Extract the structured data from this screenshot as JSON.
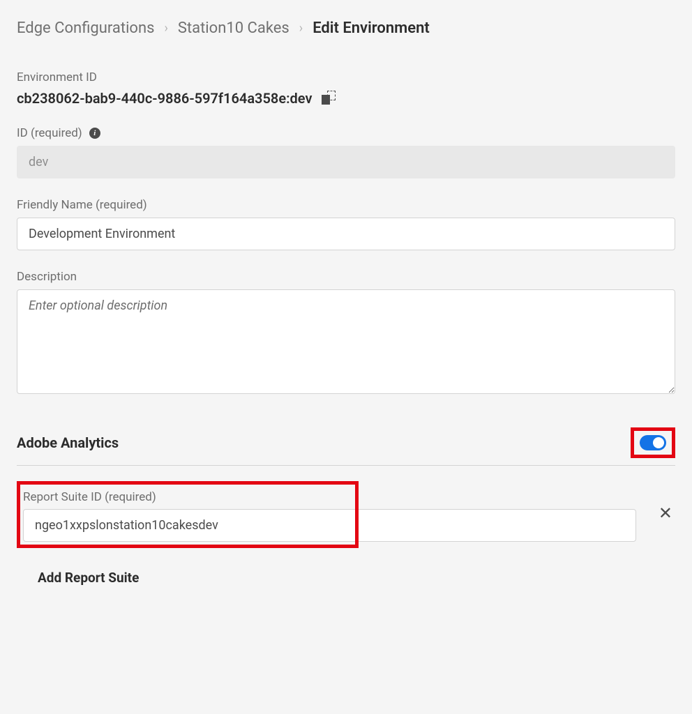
{
  "breadcrumb": {
    "items": [
      {
        "label": "Edge Configurations"
      },
      {
        "label": "Station10 Cakes"
      },
      {
        "label": "Edit Environment"
      }
    ]
  },
  "environment_id": {
    "label": "Environment ID",
    "value": "cb238062-bab9-440c-9886-597f164a358e:dev"
  },
  "id_field": {
    "label": "ID (required)",
    "value": "dev"
  },
  "friendly_name": {
    "label": "Friendly Name (required)",
    "value": "Development Environment"
  },
  "description": {
    "label": "Description",
    "placeholder": "Enter optional description",
    "value": ""
  },
  "analytics_section": {
    "title": "Adobe Analytics",
    "enabled": true
  },
  "report_suite": {
    "label": "Report Suite ID (required)",
    "value": "ngeo1xxpslonstation10cakesdev",
    "add_label": "Add Report Suite"
  }
}
